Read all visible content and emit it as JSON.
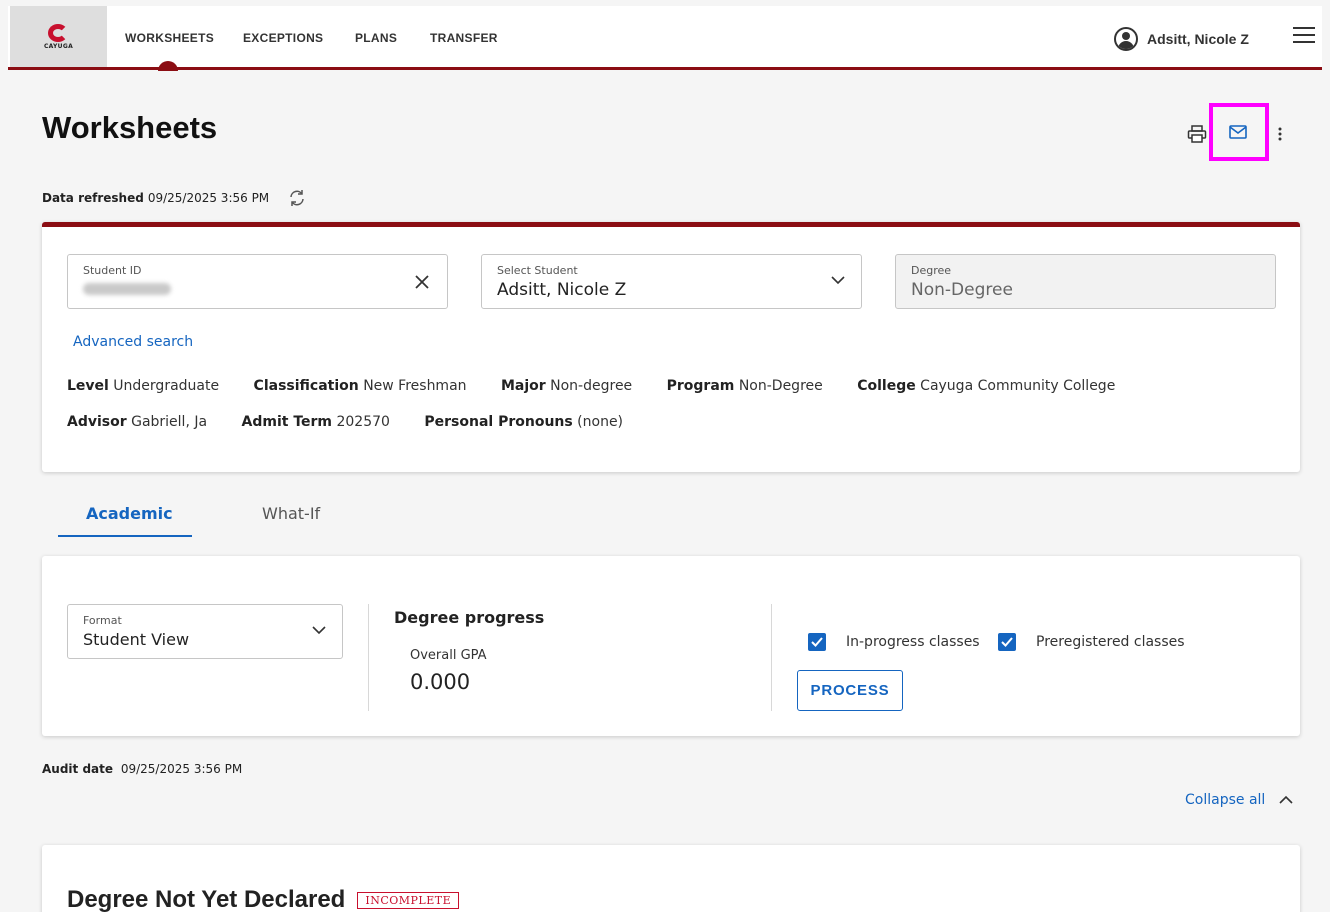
{
  "nav": {
    "logo_text": "CAYUGA",
    "links": [
      "WORKSHEETS",
      "EXCEPTIONS",
      "PLANS",
      "TRANSFER"
    ],
    "user_name": "Adsitt, Nicole Z"
  },
  "header": {
    "title": "Worksheets",
    "refresh_label": "Data refreshed",
    "refresh_time": "09/25/2025 3:56 PM"
  },
  "student": {
    "id_label": "Student ID",
    "select_label": "Select Student",
    "select_value": "Adsitt, Nicole Z",
    "degree_label": "Degree",
    "degree_value": "Non-Degree",
    "advanced_search": "Advanced search",
    "info": [
      {
        "label": "Level",
        "value": "Undergraduate"
      },
      {
        "label": "Classification",
        "value": "New Freshman"
      },
      {
        "label": "Major",
        "value": "Non-degree"
      },
      {
        "label": "Program",
        "value": "Non-Degree"
      },
      {
        "label": "College",
        "value": "Cayuga Community College"
      },
      {
        "label": "Advisor",
        "value": "Gabriell, Ja"
      },
      {
        "label": "Admit Term",
        "value": "202570"
      },
      {
        "label": "Personal Pronouns",
        "value": "(none)"
      }
    ]
  },
  "tabs": [
    {
      "label": "Academic",
      "active": true
    },
    {
      "label": "What-If",
      "active": false
    }
  ],
  "controls": {
    "format_label": "Format",
    "format_value": "Student View",
    "progress_title": "Degree progress",
    "gpa_label": "Overall GPA",
    "gpa_value": "0.000",
    "in_progress_label": "In-progress classes",
    "preregistered_label": "Preregistered classes",
    "process_label": "PROCESS"
  },
  "audit": {
    "label": "Audit date",
    "date": "09/25/2025 3:56 PM",
    "collapse_label": "Collapse all"
  },
  "degree_block": {
    "title": "Degree Not Yet Declared",
    "status": "INCOMPLETE"
  },
  "colors": {
    "brand_red": "#8b0d13",
    "link_blue": "#1565c0",
    "highlight": "#ff00ff"
  }
}
